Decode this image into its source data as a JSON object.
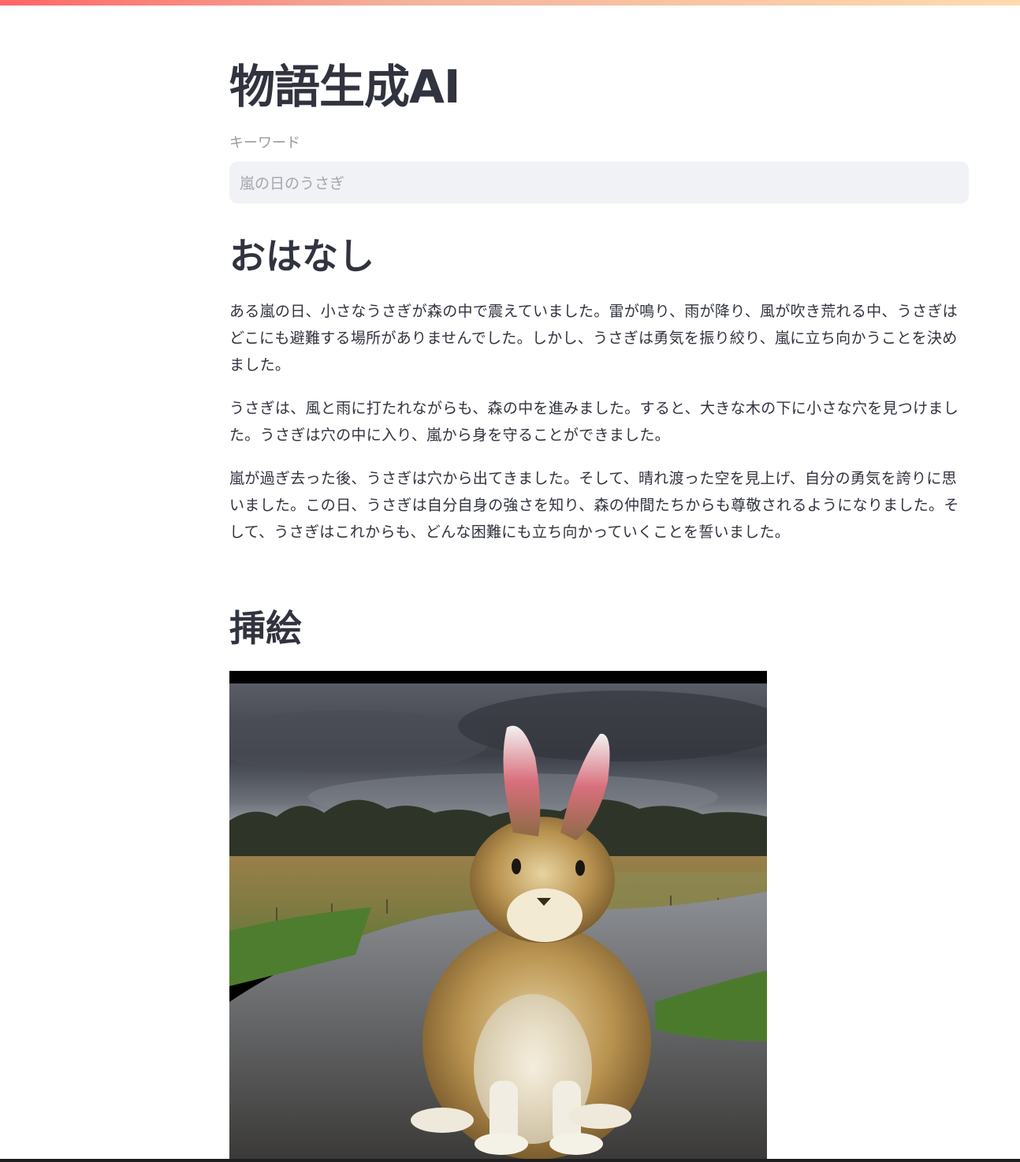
{
  "app": {
    "title": "物語生成AI"
  },
  "keyword_input": {
    "label": "キーワード",
    "value": "嵐の日のうさぎ"
  },
  "story_section": {
    "heading": "おはなし",
    "paragraphs": [
      "ある嵐の日、小さなうさぎが森の中で震えていました。雷が鳴り、雨が降り、風が吹き荒れる中、うさぎはどこにも避難する場所がありませんでした。しかし、うさぎは勇気を振り絞り、嵐に立ち向かうことを決めました。",
      "うさぎは、風と雨に打たれながらも、森の中を進みました。すると、大きな木の下に小さな穴を見つけました。うさぎは穴の中に入り、嵐から身を守ることができました。",
      "嵐が過ぎ去った後、うさぎは穴から出てきました。そして、晴れ渡った空を見上げ、自分の勇気を誇りに思いました。この日、うさぎは自分自身の強さを知り、森の仲間たちからも尊敬されるようになりました。そして、うさぎはこれからも、どんな困難にも立ち向かっていくことを誓いました。"
    ]
  },
  "illustration_section": {
    "heading": "挿絵"
  },
  "colors": {
    "accent": "#ff4b4b",
    "text": "#31333f",
    "input_background": "#f0f2f6"
  }
}
